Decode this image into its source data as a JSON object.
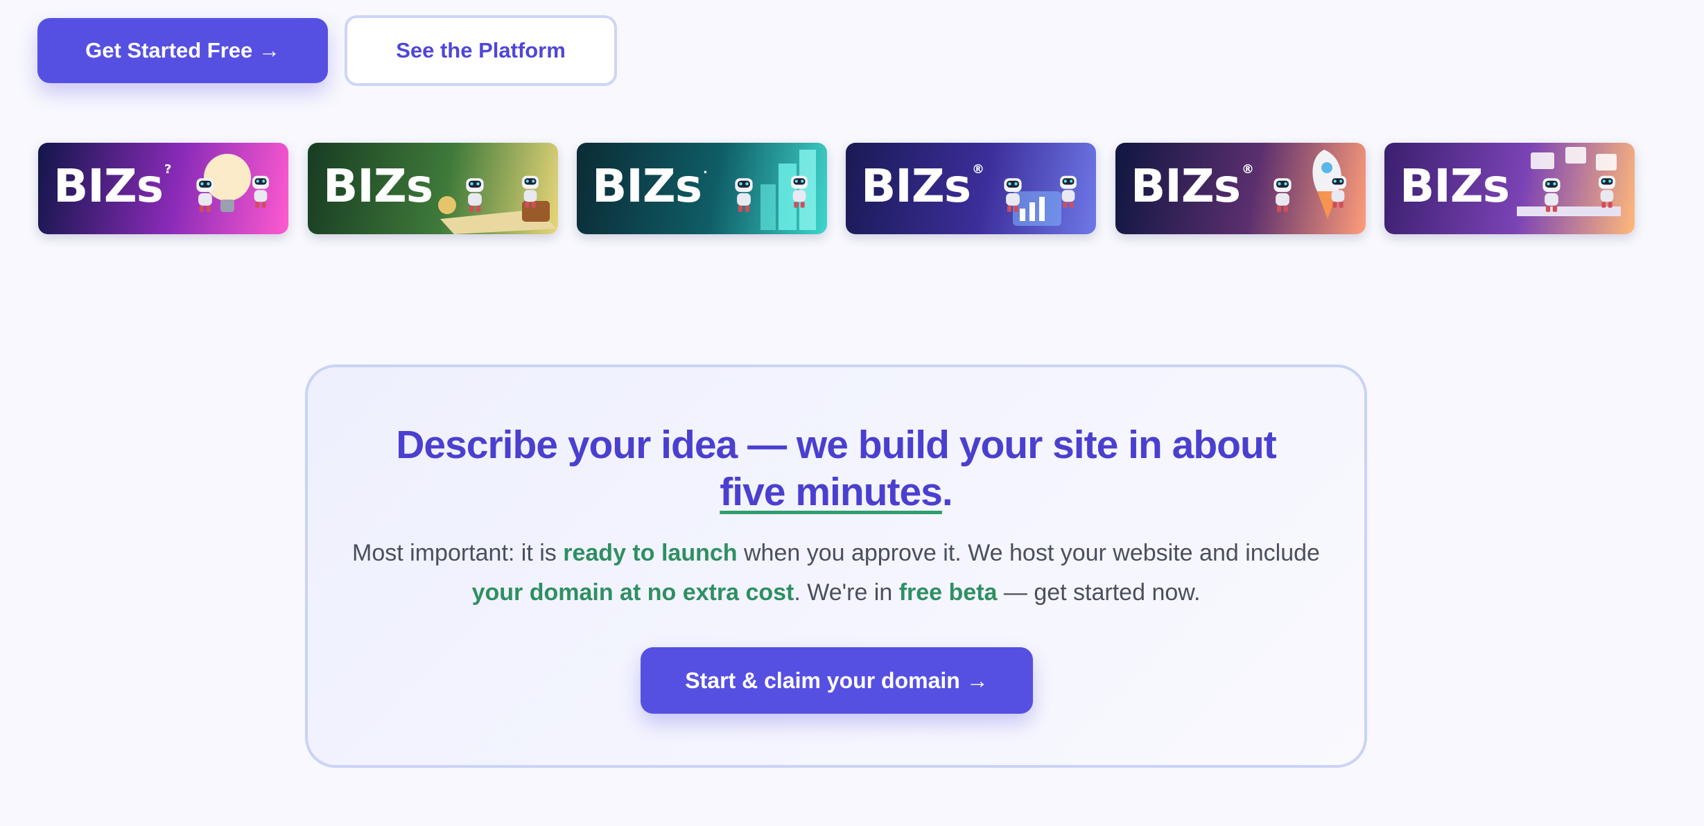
{
  "hero": {
    "primary_button": "Get Started Free →",
    "secondary_button": "See the Platform"
  },
  "banners": [
    {
      "logo": "BIZs",
      "sup": "?",
      "theme": "lightbulb",
      "colors": [
        "#12164a",
        "#8a2bb8",
        "#ff5ad0"
      ]
    },
    {
      "logo": "BIZs",
      "sup": "",
      "theme": "treasure-map",
      "colors": [
        "#173c22",
        "#3f7a3a",
        "#e8d67a"
      ]
    },
    {
      "logo": "BIZs",
      "sup": ".",
      "theme": "city",
      "colors": [
        "#0b2b35",
        "#0f5d66",
        "#3fd6cc"
      ]
    },
    {
      "logo": "BIZs",
      "sup": "®",
      "theme": "analytics",
      "colors": [
        "#191a55",
        "#3c2e9a",
        "#6f78e8"
      ]
    },
    {
      "logo": "BIZs",
      "sup": "®",
      "theme": "rocket",
      "colors": [
        "#0f1640",
        "#5b2f6e",
        "#ff9d7a"
      ]
    },
    {
      "logo": "BIZs",
      "sup": "",
      "theme": "workspace",
      "colors": [
        "#3a1f6e",
        "#7b43b5",
        "#ffb97a"
      ]
    }
  ],
  "cta": {
    "title_part1": "Describe your idea — we build your site in about",
    "title_underlined": "five minutes",
    "title_end": ".",
    "desc_1": "Most important: it is ",
    "desc_hl_1": "ready to launch",
    "desc_2": " when you approve it. We host your website and include ",
    "desc_hl_2": "your domain at no extra cost",
    "desc_3": ". We're in ",
    "desc_hl_3": "free beta",
    "desc_4": " — get started now.",
    "button": "Start & claim your domain →"
  },
  "colors": {
    "accent": "#5650e2",
    "title": "#4b3fcf",
    "highlight_green": "#2f8f62",
    "background": "#f8f8fe"
  }
}
